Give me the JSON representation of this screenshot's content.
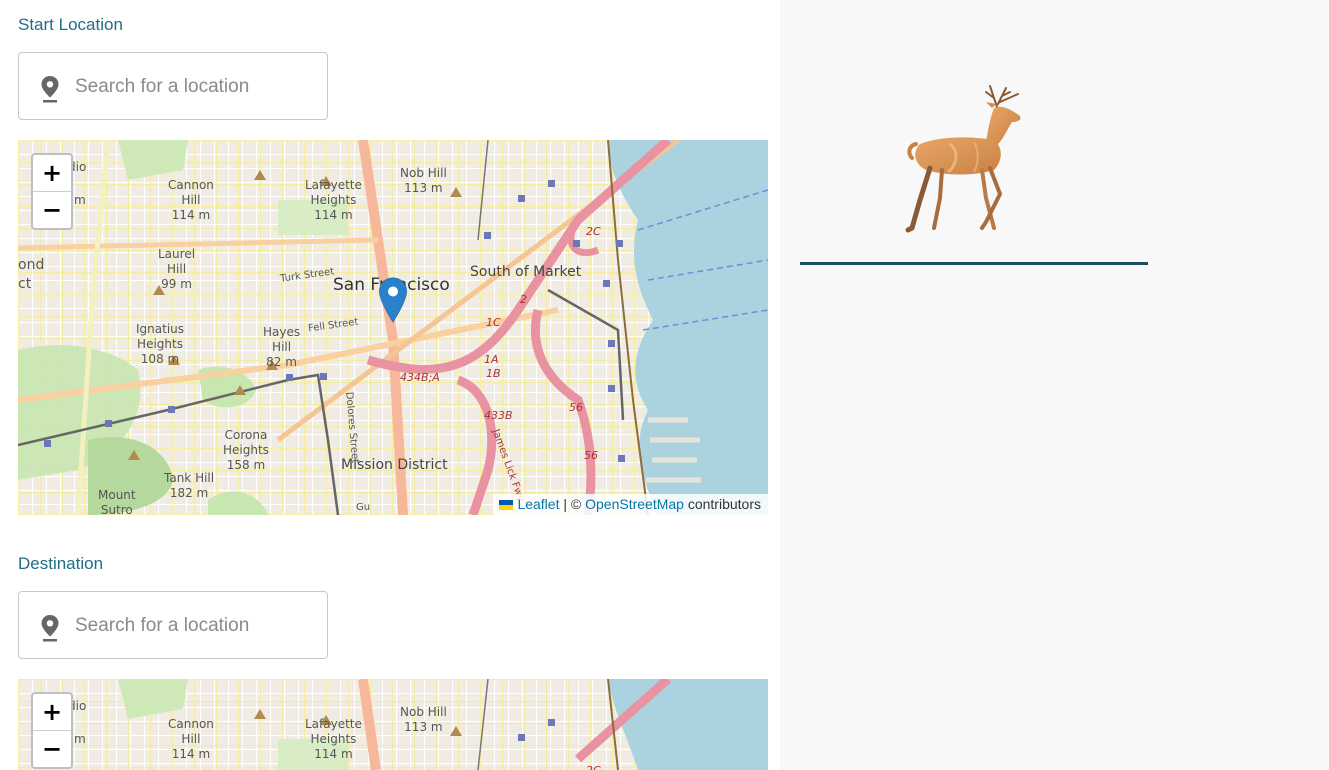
{
  "start": {
    "label": "Start Location",
    "search": {
      "placeholder": "Search for a location",
      "value": ""
    },
    "map": {
      "zoom_in": "+",
      "zoom_out": "−",
      "labels": {
        "san_francisco": "San Francisco",
        "south_of_market": "South of Market",
        "mission_district": "Mission District",
        "cannon_hill": "Cannon\nHill\n114 m",
        "lafayette_heights": "Lafayette\nHeights\n114 m",
        "nob_hill": "Nob Hill\n113 m",
        "laurel_hill": "Laurel\nHill\n99 m",
        "ignatius_heights": "Ignatius\nHeights\n108 m",
        "hayes_hill": "Hayes\nHill\n82 m",
        "corona_heights": "Corona\nHeights\n158 m",
        "tank_hill": "Tank Hill\n182 m",
        "mount_sutro": "Mount\nSutro",
        "turk_street": "Turk Street",
        "fell_street": "Fell Street",
        "dolores_street": "Dolores Street",
        "james_lick": "James Lick Fwy",
        "exit_434b": "434B;A",
        "exit_433b": "433B",
        "exit_2c": "2C",
        "exit_2": "2",
        "exit_1c": "1C",
        "exit_1a": "1A",
        "exit_1b": "1B",
        "exit_56a": "56",
        "exit_56b": "56",
        "edge_dio": "dio",
        "edge_m": "m",
        "edge_ond": "ond",
        "edge_ct": "ct",
        "edge_gu": "Gu"
      },
      "attribution": {
        "leaflet": "Leaflet",
        "sep": " | © ",
        "osm": "OpenStreetMap",
        "suffix": " contributors"
      }
    }
  },
  "destination": {
    "label": "Destination",
    "search": {
      "placeholder": "Search for a location",
      "value": ""
    },
    "map": {
      "zoom_in": "+",
      "zoom_out": "−",
      "labels": {
        "cannon_hill": "Cannon\nHill\n114 m",
        "lafayette_heights": "Lafayette\nHeights\n114 m",
        "nob_hill": "Nob Hill\n113 m",
        "edge_dio": "dio",
        "edge_m": "m",
        "exit_2c": "2C"
      }
    }
  },
  "side": {
    "illustration": "deer-illustration"
  },
  "colors": {
    "accent_text": "#1f6f84",
    "underline": "#1b5062",
    "water": "#aad3df",
    "motorway": "#e892a2",
    "marker": "#2a81cb"
  },
  "icons": [
    "location-pin-icon",
    "zoom-in-icon",
    "zoom-out-icon",
    "map-marker-icon",
    "ukraine-flag-icon",
    "deer-illustration"
  ]
}
